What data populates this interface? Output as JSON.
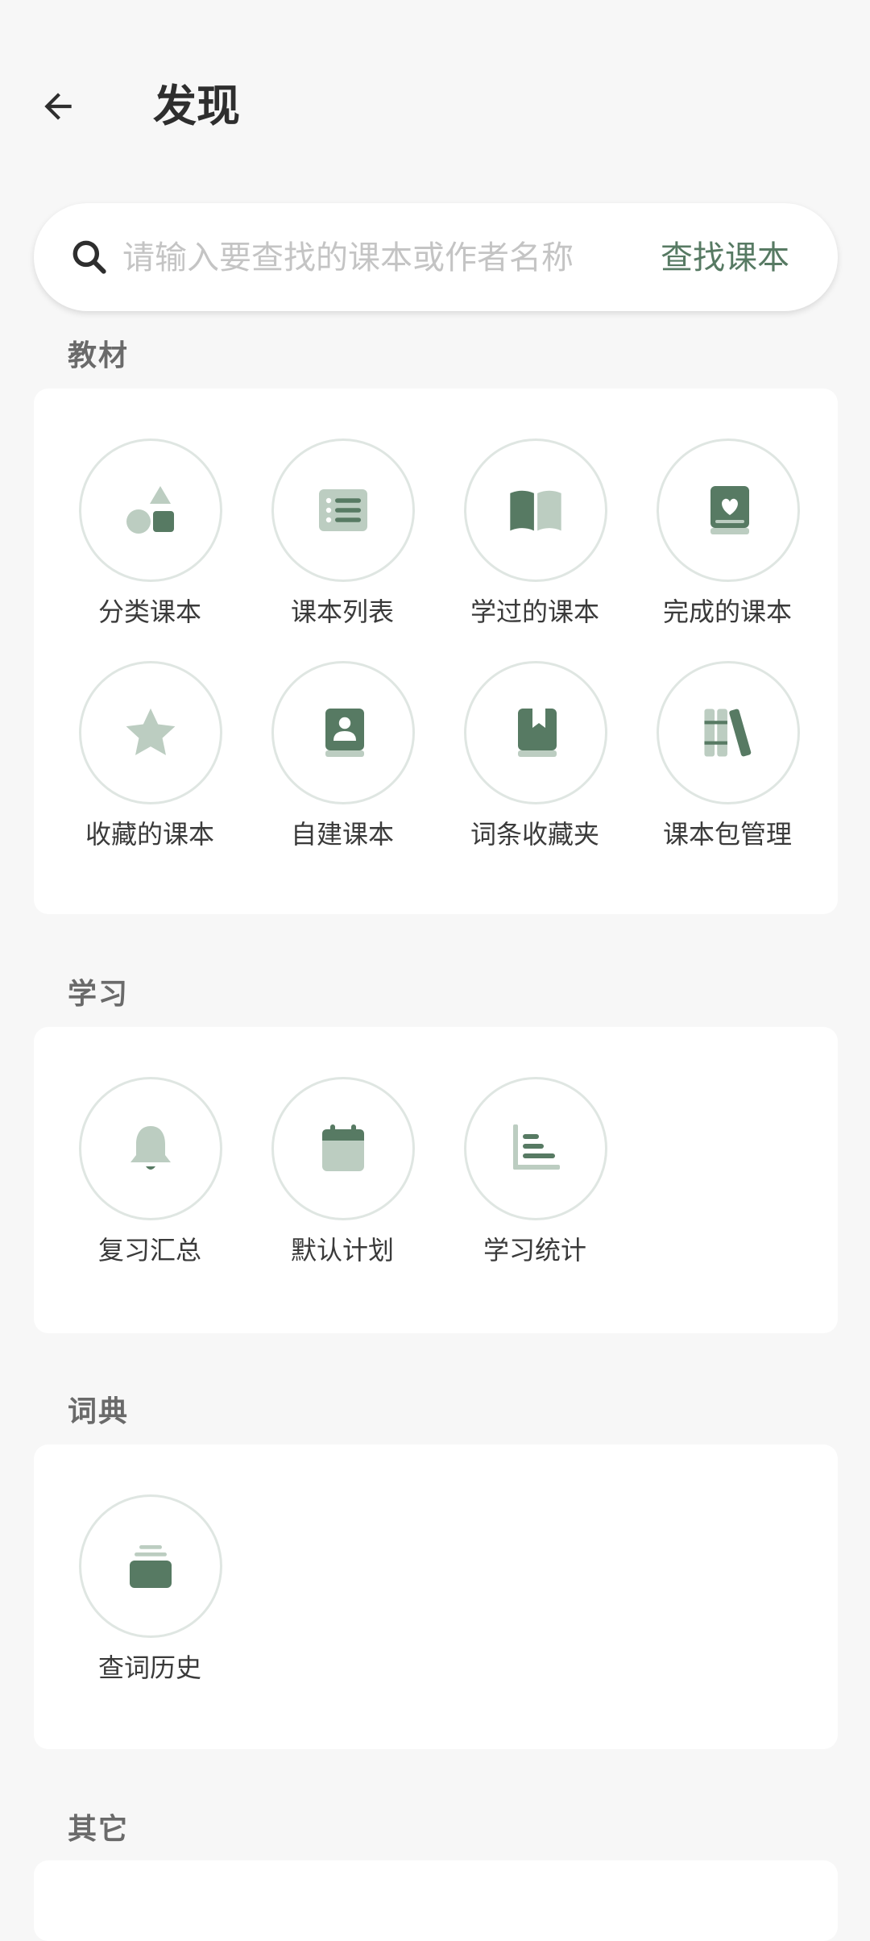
{
  "header": {
    "title": "发现"
  },
  "search": {
    "placeholder": "请输入要查找的课本或作者名称",
    "button_label": "查找课本"
  },
  "sections": [
    {
      "title": "教材",
      "items": [
        {
          "label": "分类课本",
          "icon": "shapes-icon"
        },
        {
          "label": "课本列表",
          "icon": "list-icon"
        },
        {
          "label": "学过的课本",
          "icon": "open-book-icon"
        },
        {
          "label": "完成的课本",
          "icon": "heart-book-icon"
        },
        {
          "label": "收藏的课本",
          "icon": "star-icon"
        },
        {
          "label": "自建课本",
          "icon": "contact-book-icon"
        },
        {
          "label": "词条收藏夹",
          "icon": "bookmark-book-icon"
        },
        {
          "label": "课本包管理",
          "icon": "library-icon"
        }
      ]
    },
    {
      "title": "学习",
      "items": [
        {
          "label": "复习汇总",
          "icon": "bell-icon"
        },
        {
          "label": "默认计划",
          "icon": "calendar-icon"
        },
        {
          "label": "学习统计",
          "icon": "bar-chart-icon"
        }
      ]
    },
    {
      "title": "词典",
      "items": [
        {
          "label": "查词历史",
          "icon": "stack-icon"
        }
      ]
    },
    {
      "title": "其它",
      "items": []
    }
  ],
  "colors": {
    "accent": "#577a63",
    "icon_light": "#bccdc1",
    "background": "#f7f7f7",
    "card": "#ffffff"
  }
}
